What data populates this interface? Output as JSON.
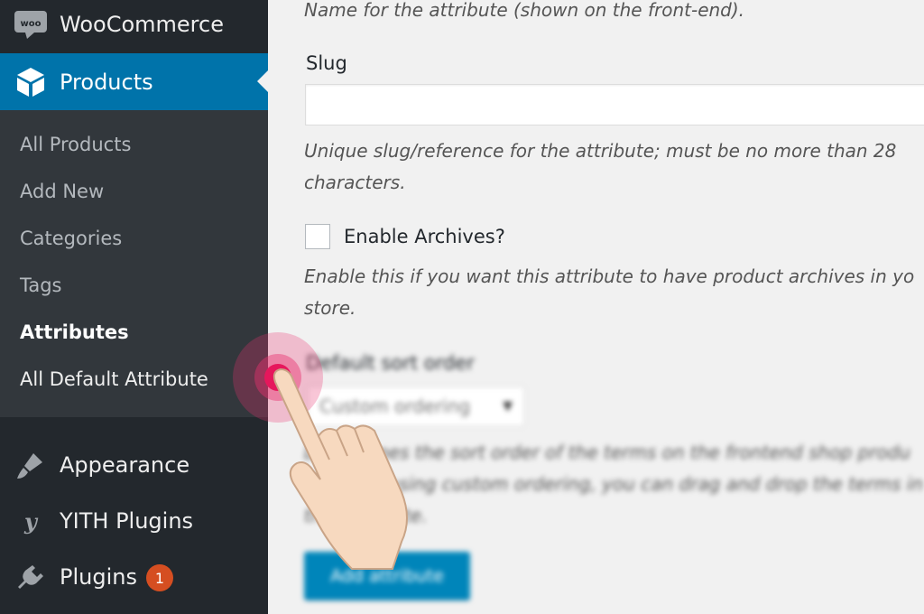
{
  "sidebar": {
    "woocommerce_label": "WooCommerce",
    "products_label": "Products",
    "submenu": [
      {
        "label": "All Products"
      },
      {
        "label": "Add New"
      },
      {
        "label": "Categories"
      },
      {
        "label": "Tags"
      },
      {
        "label": "Attributes",
        "current": true
      },
      {
        "label": "All Default Attribute"
      }
    ],
    "appearance_label": "Appearance",
    "yith_label": "YITH Plugins",
    "plugins_label": "Plugins",
    "plugins_badge": "1"
  },
  "form": {
    "name_help": "Name for the attribute (shown on the front-end).",
    "slug_label": "Slug",
    "slug_value": "",
    "slug_help_line1": "Unique slug/reference for the attribute; must be no more than 28",
    "slug_help_line2": "characters.",
    "archives_label": "Enable Archives?",
    "archives_help_line1": "Enable this if you want this attribute to have product archives in yo",
    "archives_help_line2": "store.",
    "sort_label": "Default sort order",
    "sort_selected": "Custom ordering",
    "sort_help_line1": "Determines the sort order of the terms on the frontend shop produ",
    "sort_help_line2": "pages. If using custom ordering, you can drag and drop the terms in",
    "sort_help_line3": "this attribute.",
    "add_button_label": "Add attribute"
  },
  "colors": {
    "sidebar_bg": "#23282d",
    "submenu_bg": "#32373c",
    "active_menu": "#0073aa",
    "button": "#0085ba",
    "tap_indicator": "#e6175c",
    "badge": "#d54e21"
  },
  "icons": {
    "woocommerce": "woocommerce-icon",
    "products": "cube-icon",
    "appearance": "paintbrush-icon",
    "yith": "yith-icon",
    "plugins": "plug-icon"
  }
}
